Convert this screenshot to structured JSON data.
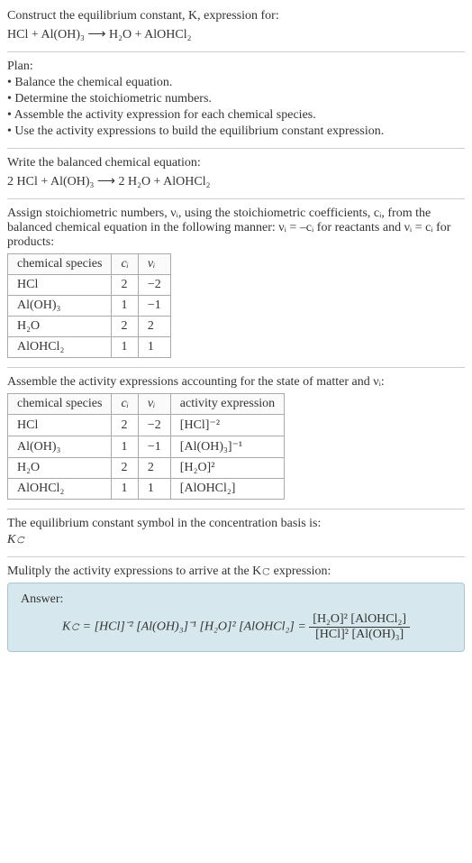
{
  "title_line1": "Construct the equilibrium constant, K, expression for:",
  "reaction_unbalanced": "HCl + Al(OH)₃  ⟶  H₂O + AlOHCl₂",
  "plan_header": "Plan:",
  "plan_items": [
    "• Balance the chemical equation.",
    "• Determine the stoichiometric numbers.",
    "• Assemble the activity expression for each chemical species.",
    "• Use the activity expressions to build the equilibrium constant expression."
  ],
  "balanced_header": "Write the balanced chemical equation:",
  "reaction_balanced": "2 HCl + Al(OH)₃  ⟶  2 H₂O + AlOHCl₂",
  "assign_text_1": "Assign stoichiometric numbers, νᵢ, using the stoichiometric coefficients, cᵢ, from the balanced chemical equation in the following manner: νᵢ = –cᵢ for reactants and νᵢ = cᵢ for products:",
  "table1_headers": [
    "chemical species",
    "cᵢ",
    "νᵢ"
  ],
  "table1_rows": [
    [
      "HCl",
      "2",
      "−2"
    ],
    [
      "Al(OH)₃",
      "1",
      "−1"
    ],
    [
      "H₂O",
      "2",
      "2"
    ],
    [
      "AlOHCl₂",
      "1",
      "1"
    ]
  ],
  "assemble_text": "Assemble the activity expressions accounting for the state of matter and νᵢ:",
  "table2_headers": [
    "chemical species",
    "cᵢ",
    "νᵢ",
    "activity expression"
  ],
  "table2_rows": [
    [
      "HCl",
      "2",
      "−2",
      "[HCl]⁻²"
    ],
    [
      "Al(OH)₃",
      "1",
      "−1",
      "[Al(OH)₃]⁻¹"
    ],
    [
      "H₂O",
      "2",
      "2",
      "[H₂O]²"
    ],
    [
      "AlOHCl₂",
      "1",
      "1",
      "[AlOHCl₂]"
    ]
  ],
  "kc_symbol_line1": "The equilibrium constant symbol in the concentration basis is:",
  "kc_symbol_line2": "K𝚌",
  "multiply_text": "Mulitply the activity expressions to arrive at the K𝚌 expression:",
  "answer_label": "Answer:",
  "answer_lhs": "K𝚌 = [HCl]⁻² [Al(OH)₃]⁻¹ [H₂O]² [AlOHCl₂] = ",
  "answer_num": "[H₂O]² [AlOHCl₂]",
  "answer_den": "[HCl]² [Al(OH)₃]",
  "chart_data": {
    "type": "table",
    "tables": [
      {
        "columns": [
          "chemical species",
          "c_i",
          "nu_i"
        ],
        "rows": [
          [
            "HCl",
            2,
            -2
          ],
          [
            "Al(OH)3",
            1,
            -1
          ],
          [
            "H2O",
            2,
            2
          ],
          [
            "AlOHCl2",
            1,
            1
          ]
        ]
      },
      {
        "columns": [
          "chemical species",
          "c_i",
          "nu_i",
          "activity expression"
        ],
        "rows": [
          [
            "HCl",
            2,
            -2,
            "[HCl]^-2"
          ],
          [
            "Al(OH)3",
            1,
            -1,
            "[Al(OH)3]^-1"
          ],
          [
            "H2O",
            2,
            2,
            "[H2O]^2"
          ],
          [
            "AlOHCl2",
            1,
            1,
            "[AlOHCl2]"
          ]
        ]
      }
    ]
  }
}
